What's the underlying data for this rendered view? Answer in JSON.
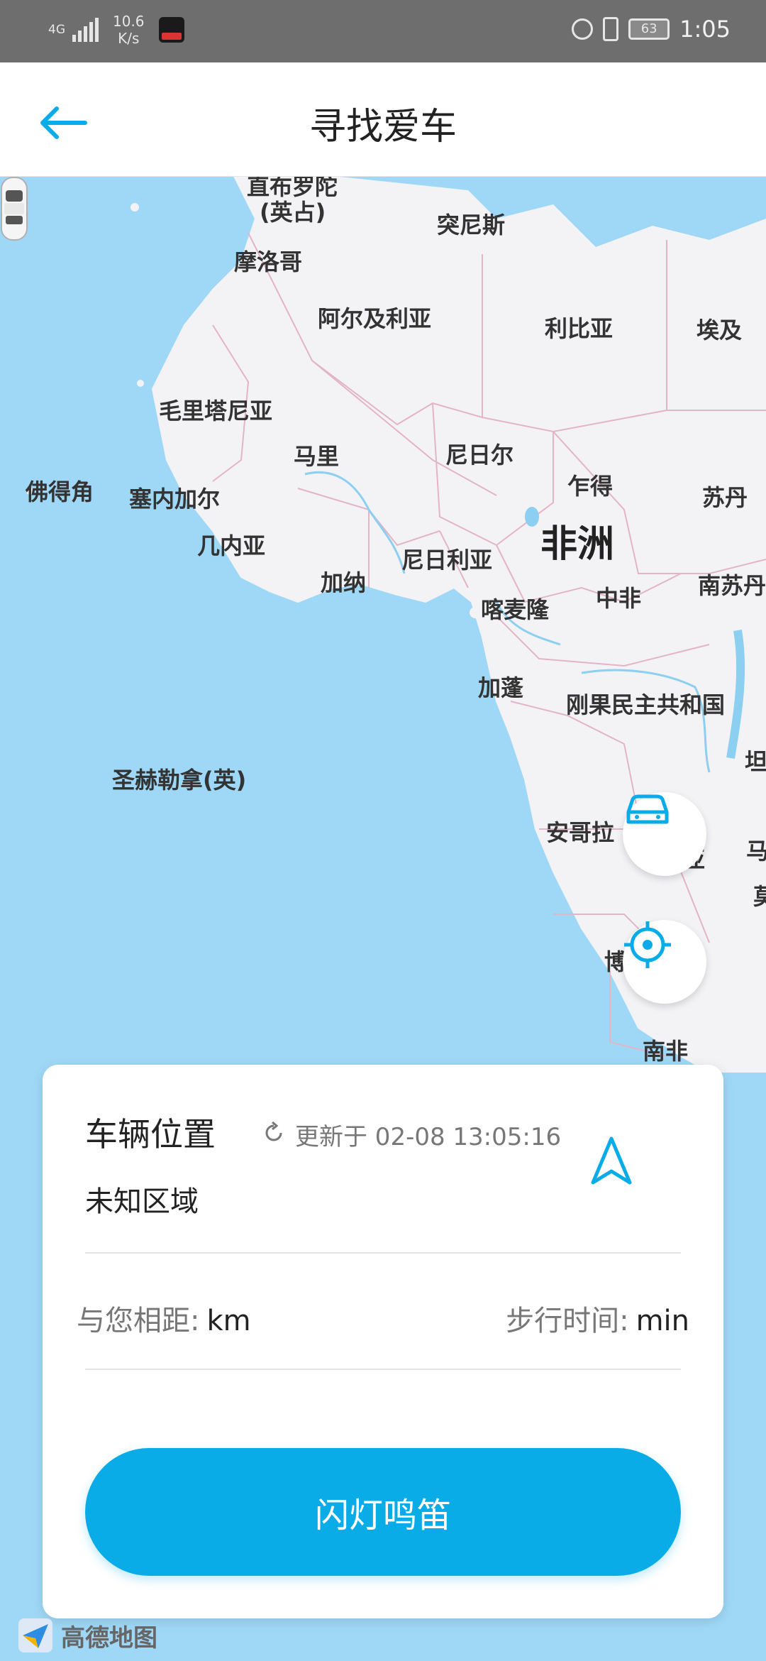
{
  "status_bar": {
    "network": "4G",
    "speed_value": "10.6",
    "speed_unit": "K/s",
    "battery": "63",
    "time": "1:05"
  },
  "header": {
    "title": "寻找爱车",
    "back_icon": "arrow-left-icon"
  },
  "map": {
    "labels": [
      "直布罗陀",
      "(英占)",
      "突尼斯",
      "摩洛哥",
      "阿尔及利亚",
      "利比亚",
      "埃及",
      "毛里塔尼亚",
      "马里",
      "尼日尔",
      "乍得",
      "苏丹",
      "佛得角",
      "塞内加尔",
      "几内亚",
      "加纳",
      "尼日利亚",
      "非洲",
      "中非",
      "南苏丹",
      "喀麦隆",
      "加蓬",
      "刚果民主共和国",
      "坦",
      "圣赫勒拿(英)",
      "安哥拉",
      "亚",
      "马",
      "莫",
      "博",
      "南非"
    ]
  },
  "buttons": {
    "car_locate_icon": "car-icon",
    "my_location_icon": "crosshair-icon"
  },
  "card": {
    "title": "车辆位置",
    "update_text": "更新于 02-08 13:05:16",
    "location": "未知区域",
    "distance_label": "与您相距:",
    "distance_value": "km",
    "walk_label": "步行时间:",
    "walk_value": "min",
    "action_button": "闪灯鸣笛"
  },
  "footer": {
    "logo_text": "高德地图"
  },
  "colors": {
    "accent": "#0aace8",
    "ocean": "#9fd8f6",
    "land": "#f3f3f6",
    "border": "#e8b8c8"
  }
}
